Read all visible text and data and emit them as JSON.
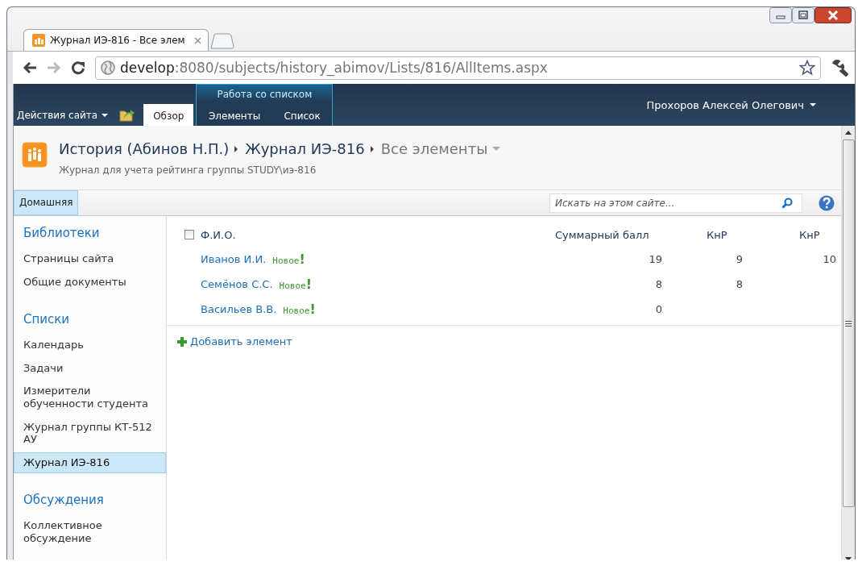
{
  "browser_tab": {
    "title": "Журнал ИЭ-816 - Все элем"
  },
  "address_bar": {
    "host": "develop",
    "path": ":8080/subjects/history_abimov/Lists/816/AllItems.aspx"
  },
  "ribbon": {
    "site_actions": "Действия сайта",
    "tabs": [
      {
        "label": "Обзор",
        "selected": true
      }
    ],
    "context_group": {
      "title": "Работа со списком",
      "tabs": [
        {
          "label": "Элементы",
          "selected": false
        },
        {
          "label": "Список",
          "selected": false
        }
      ]
    },
    "user": "Прохоров Алексей Олегович"
  },
  "header": {
    "breadcrumb": [
      "История (Абинов Н.П.)",
      "Журнал ИЭ-816",
      "Все элементы"
    ],
    "description": "Журнал для учета рейтинга группы STUDY\\иэ-816"
  },
  "top_nav": {
    "items": [
      {
        "label": "Домашняя",
        "selected": true
      }
    ]
  },
  "search": {
    "placeholder": "Искать на этом сайте..."
  },
  "sidebar": {
    "sections": [
      {
        "heading": "Библиотеки",
        "items": [
          {
            "label": "Страницы сайта",
            "selected": false
          },
          {
            "label": "Общие документы",
            "selected": false
          }
        ]
      },
      {
        "heading": "Списки",
        "items": [
          {
            "label": "Календарь",
            "selected": false
          },
          {
            "label": "Задачи",
            "selected": false
          },
          {
            "label": "Измерители обученности студента",
            "selected": false
          },
          {
            "label": "Журнал группы КТ-512 АУ",
            "selected": false
          },
          {
            "label": "Журнал ИЭ-816",
            "selected": true
          }
        ]
      },
      {
        "heading": "Обсуждения",
        "items": [
          {
            "label": "Коллективное обсуждение",
            "selected": false
          }
        ]
      }
    ]
  },
  "table": {
    "select_all": {
      "checked": false
    },
    "columns": [
      "Ф.И.О.",
      "Суммарный балл",
      "КнР",
      "КнР"
    ],
    "rows": [
      {
        "cells": [
          "Иванов И.И.",
          "19",
          "9",
          "10"
        ],
        "badge": {
          "text": "Новое",
          "mark": "!"
        }
      },
      {
        "cells": [
          "Семёнов С.С.",
          "8",
          "8",
          null
        ],
        "badge": {
          "text": "Новое",
          "mark": "!"
        }
      },
      {
        "cells": [
          "Васильев В.В.",
          "0",
          null,
          null
        ],
        "badge": {
          "text": "Новое",
          "mark": "!"
        }
      }
    ]
  },
  "add_link": "Добавить элемент"
}
